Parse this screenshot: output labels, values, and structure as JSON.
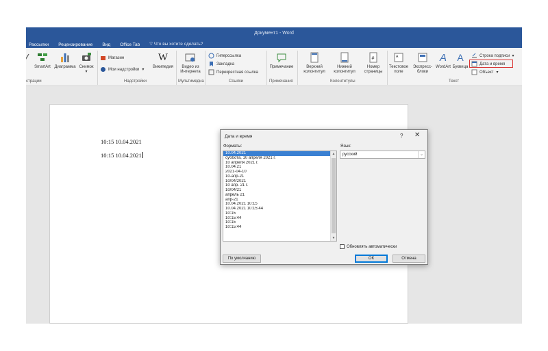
{
  "app": {
    "window_title": "Документ1 - Word",
    "accent_color": "#2b579a"
  },
  "tabs": [
    {
      "label": "Рассылки"
    },
    {
      "label": "Рецензирование"
    },
    {
      "label": "Вид"
    },
    {
      "label": "Office Tab"
    }
  ],
  "tell_me": "Что вы хотите сделать?",
  "ribbon": {
    "illustrations": {
      "smartart": "SmartArt",
      "chart": "Диаграмма",
      "screenshot": "Снимок",
      "group_label": "страции"
    },
    "addins": {
      "store": "Магазин",
      "my_addins": "Мои надстройки",
      "wikipedia": "Википедия",
      "group_label": "Надстройки"
    },
    "media": {
      "online_video_line1": "Видео из",
      "online_video_line2": "Интернета",
      "group_label": "Мультимедиа"
    },
    "links": {
      "hyperlink": "Гиперссылка",
      "bookmark": "Закладка",
      "cross_reference": "Перекрестная ссылка",
      "group_label": "Ссылки"
    },
    "comments": {
      "comment": "Примечание",
      "group_label": "Примечания"
    },
    "header_footer": {
      "header_line1": "Верхний",
      "header_line2": "колонтитул",
      "footer_line1": "Нижний",
      "footer_line2": "колонтитул",
      "page_number_line1": "Номер",
      "page_number_line2": "страницы",
      "group_label": "Колонтитулы"
    },
    "text": {
      "textbox_line1": "Текстовое",
      "textbox_line2": "поле",
      "quickparts_line1": "Экспресс-",
      "quickparts_line2": "блоки",
      "wordart": "WordArt",
      "dropcap": "Буквица",
      "signature_line": "Строка подписи",
      "date_time": "Дата и время",
      "object": "Объект",
      "group_label": "Текст"
    }
  },
  "document": {
    "lines": [
      "10:15 10.04.2021",
      "10:15 10.04.2021"
    ]
  },
  "dialog": {
    "title": "Дата и время",
    "help": "?",
    "close": "✕",
    "formats_label": "Форматы:",
    "formats": [
      "10.04.2021",
      "суббота, 10 апреля 2021 г.",
      "10 апреля 2021 г.",
      "10.04.21",
      "2021-04-10",
      "10-апр-21",
      "10/04/2021",
      "10 апр. 21 г.",
      "10/04/21",
      "апрель 21",
      "апр-21",
      "10.04.2021 10:15",
      "10.04.2021 10:15:44",
      "10:15",
      "10:15:44",
      "10:15",
      "10:15:44"
    ],
    "selected_index": 0,
    "language_label": "Язык:",
    "language_value": "русский",
    "auto_update_label": "Обновлять автоматически",
    "auto_update_checked": false,
    "default_button": "По умолчанию",
    "ok_button": "ОК",
    "cancel_button": "Отмена"
  }
}
